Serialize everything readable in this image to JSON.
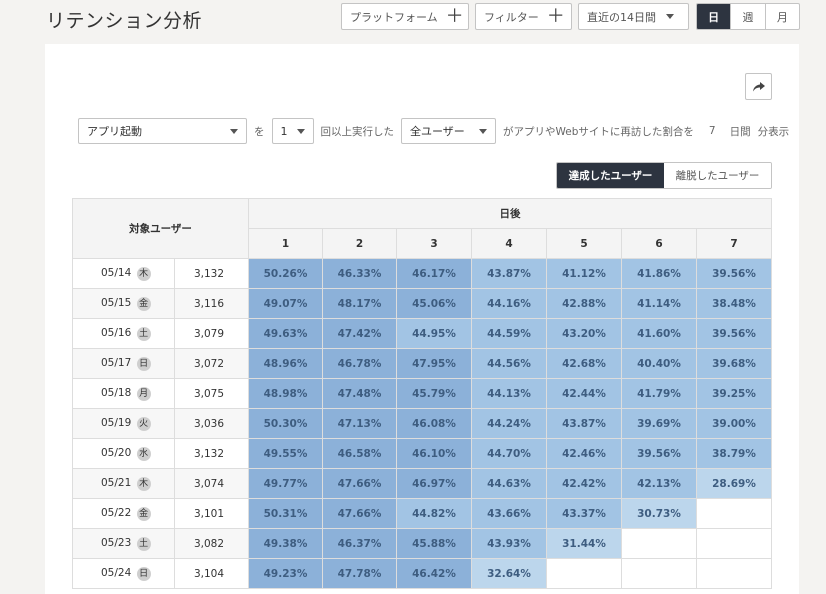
{
  "header": {
    "title": "リテンション分析",
    "platform_label": "プラットフォーム",
    "filter_label": "フィルター",
    "period_label": "直近の14日間",
    "granularity": [
      "日",
      "週",
      "月"
    ]
  },
  "filter": {
    "event": "アプリ起動",
    "particle_wo": "を",
    "count": "1",
    "times_text": "回以上実行した",
    "segment": "全ユーザー",
    "sentence": "がアプリやWebサイトに再訪した割合を",
    "days": "7",
    "unit_days": "日間",
    "minute_display": "分表示"
  },
  "toggle": {
    "achieved": "達成したユーザー",
    "churned": "離脱したユーザー"
  },
  "table": {
    "target_header": "対象ユーザー",
    "days_after_header": "日後",
    "day_columns": [
      "1",
      "2",
      "3",
      "4",
      "5",
      "6",
      "7"
    ],
    "rows": [
      {
        "date": "05/14",
        "dow": "木",
        "count": "3,132",
        "values": [
          "50.26%",
          "46.33%",
          "46.17%",
          "43.87%",
          "41.12%",
          "41.86%",
          "39.56%"
        ]
      },
      {
        "date": "05/15",
        "dow": "金",
        "count": "3,116",
        "values": [
          "49.07%",
          "48.17%",
          "45.06%",
          "44.16%",
          "42.88%",
          "41.14%",
          "38.48%"
        ]
      },
      {
        "date": "05/16",
        "dow": "土",
        "count": "3,079",
        "values": [
          "49.63%",
          "47.42%",
          "44.95%",
          "44.59%",
          "43.20%",
          "41.60%",
          "39.56%"
        ]
      },
      {
        "date": "05/17",
        "dow": "日",
        "count": "3,072",
        "values": [
          "48.96%",
          "46.78%",
          "47.95%",
          "44.56%",
          "42.68%",
          "40.40%",
          "39.68%"
        ]
      },
      {
        "date": "05/18",
        "dow": "月",
        "count": "3,075",
        "values": [
          "48.98%",
          "47.48%",
          "45.79%",
          "44.13%",
          "42.44%",
          "41.79%",
          "39.25%"
        ]
      },
      {
        "date": "05/19",
        "dow": "火",
        "count": "3,036",
        "values": [
          "50.30%",
          "47.13%",
          "46.08%",
          "44.24%",
          "43.87%",
          "39.69%",
          "39.00%"
        ]
      },
      {
        "date": "05/20",
        "dow": "水",
        "count": "3,132",
        "values": [
          "49.55%",
          "46.58%",
          "46.10%",
          "44.70%",
          "42.46%",
          "39.56%",
          "38.79%"
        ]
      },
      {
        "date": "05/21",
        "dow": "木",
        "count": "3,074",
        "values": [
          "49.77%",
          "47.66%",
          "46.97%",
          "44.63%",
          "42.42%",
          "42.13%",
          "28.69%"
        ]
      },
      {
        "date": "05/22",
        "dow": "金",
        "count": "3,101",
        "values": [
          "50.31%",
          "47.66%",
          "44.82%",
          "43.66%",
          "43.37%",
          "30.73%",
          ""
        ]
      },
      {
        "date": "05/23",
        "dow": "土",
        "count": "3,082",
        "values": [
          "49.38%",
          "46.37%",
          "45.88%",
          "43.93%",
          "31.44%",
          "",
          ""
        ]
      },
      {
        "date": "05/24",
        "dow": "日",
        "count": "3,104",
        "values": [
          "49.23%",
          "47.78%",
          "46.42%",
          "32.64%",
          "",
          "",
          ""
        ]
      }
    ]
  },
  "colors": {
    "heat_dark": "#8cb1d9",
    "heat_mid": "#a2c4e4",
    "heat_light": "#bcd6ec",
    "active_dark": "#2d3440"
  }
}
